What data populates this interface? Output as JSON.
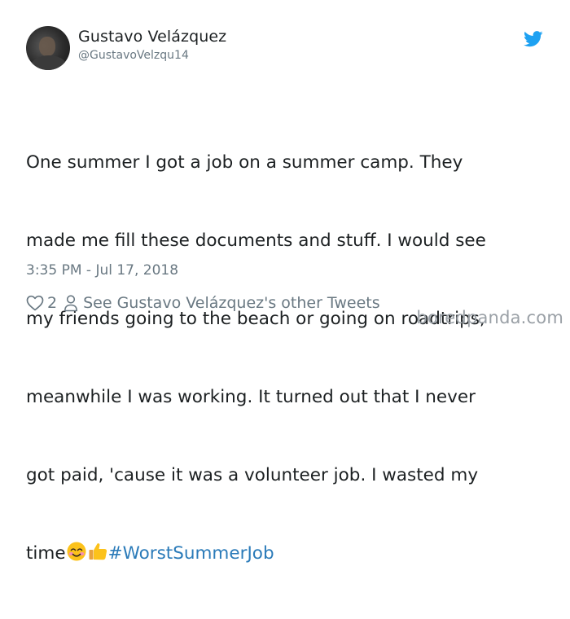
{
  "tweet": {
    "author_name": "Gustavo Velázquez",
    "author_handle": "@GustavoVelzqu14",
    "text_lines": [
      "One summer I got a job on a summer camp. They",
      "made me fill these documents and stuff. I would see",
      "my friends going to the beach or going on roadtrips,",
      "meanwhile I was working. It turned out that I never",
      "got paid, 'cause it was a volunteer job. I wasted my"
    ],
    "last_line_text": "time",
    "hashtag": "#WorstSummerJob",
    "emojis": [
      "smiling-face-with-smiling-eyes-icon",
      "thumbs-up-icon"
    ],
    "timestamp": "3:35 PM - Jul 17, 2018",
    "likes_count": "2",
    "other_tweets_link": "See Gustavo Velázquez's other Tweets"
  },
  "icons": {
    "brand": "twitter-bird-icon",
    "like": "heart-icon",
    "profile": "person-icon"
  },
  "colors": {
    "twitter_blue": "#1da1f2",
    "hashtag": "#2b7bb9",
    "meta_gray": "#697882",
    "text": "#1c2022"
  },
  "watermark": "boredpanda.com"
}
